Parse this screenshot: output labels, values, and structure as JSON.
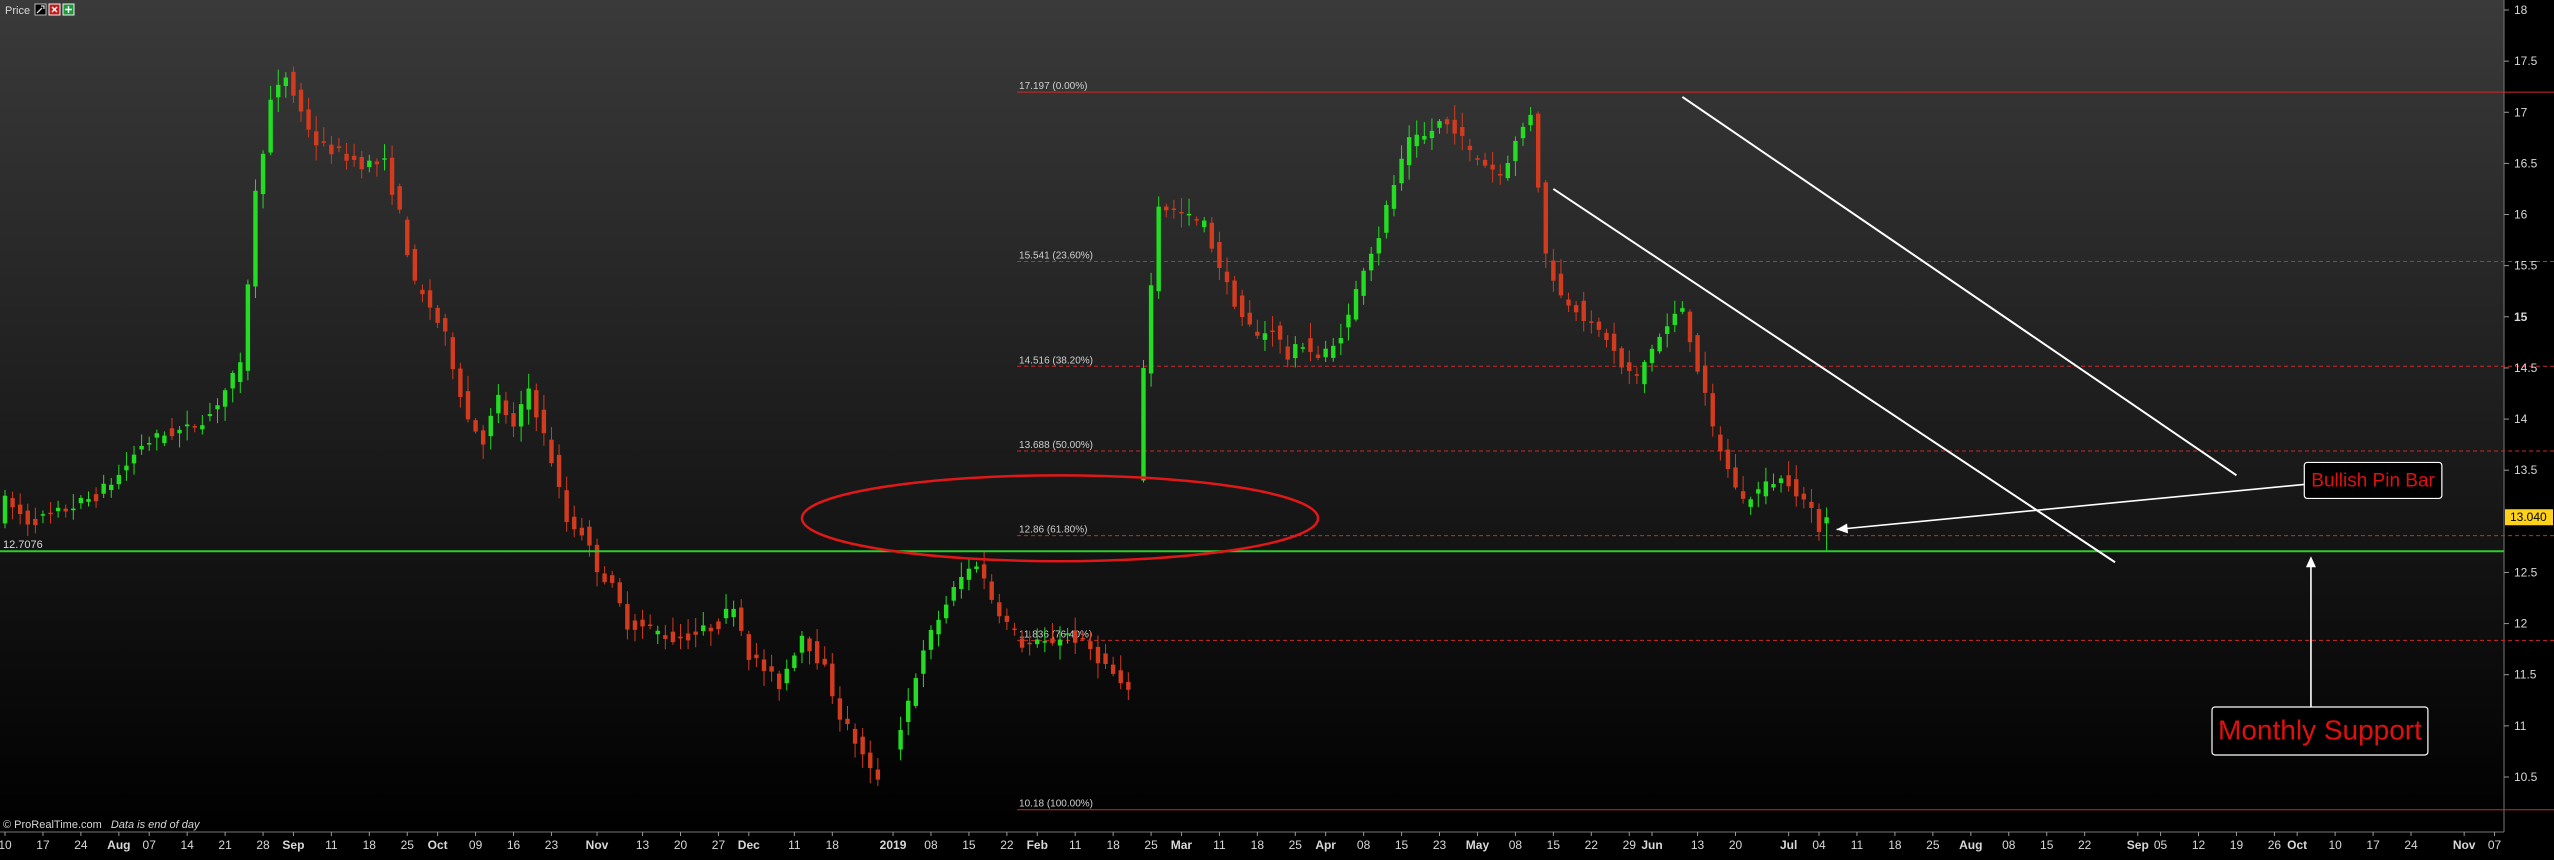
{
  "header": {
    "label": "Price",
    "tool_icons": [
      "wrench-icon",
      "close-icon",
      "add-icon"
    ]
  },
  "footer": {
    "source": "© ProRealTime.com",
    "note": "Data is end of day"
  },
  "colors": {
    "background_top": "#3a3a3a",
    "background_bottom": "#000000",
    "up_candle": "#22dd22",
    "down_candle": "#d23b1e",
    "support_line": "#2ecc2e",
    "fib_line": "#cc2a2a",
    "annotation_text": "#e01010",
    "channel": "#ffffff",
    "price_tag": "#ffd21a"
  },
  "chart_data": {
    "type": "candlestick",
    "y_axis": {
      "min": 10.0,
      "max": 18.2,
      "ticks": [
        {
          "value": 18,
          "label": "18"
        },
        {
          "value": 17.5,
          "label": "17.5"
        },
        {
          "value": 17,
          "label": "17"
        },
        {
          "value": 16.5,
          "label": "16.5"
        },
        {
          "value": 16,
          "label": "16"
        },
        {
          "value": 15.5,
          "label": "15.5"
        },
        {
          "value": 15,
          "label": "15"
        },
        {
          "value": 14.5,
          "label": "14.5"
        },
        {
          "value": 14,
          "label": "14"
        },
        {
          "value": 13.5,
          "label": "13.5"
        },
        {
          "value": 12.5,
          "label": "12.5"
        },
        {
          "value": 12,
          "label": "12"
        },
        {
          "value": 11.5,
          "label": "11.5"
        },
        {
          "value": 11,
          "label": "11"
        },
        {
          "value": 10.5,
          "label": "10.5"
        }
      ]
    },
    "x_axis": {
      "ticks": [
        {
          "i": 0,
          "label": "10"
        },
        {
          "i": 5,
          "label": "17"
        },
        {
          "i": 10,
          "label": "24"
        },
        {
          "i": 15,
          "label": "Aug",
          "bold": true
        },
        {
          "i": 19,
          "label": "07"
        },
        {
          "i": 24,
          "label": "14"
        },
        {
          "i": 29,
          "label": "21"
        },
        {
          "i": 34,
          "label": "28"
        },
        {
          "i": 38,
          "label": "Sep",
          "bold": true
        },
        {
          "i": 43,
          "label": "11"
        },
        {
          "i": 48,
          "label": "18"
        },
        {
          "i": 53,
          "label": "25"
        },
        {
          "i": 57,
          "label": "Oct",
          "bold": true
        },
        {
          "i": 62,
          "label": "09"
        },
        {
          "i": 67,
          "label": "16"
        },
        {
          "i": 72,
          "label": "23"
        },
        {
          "i": 78,
          "label": "Nov",
          "bold": true
        },
        {
          "i": 84,
          "label": "13"
        },
        {
          "i": 89,
          "label": "20"
        },
        {
          "i": 94,
          "label": "27"
        },
        {
          "i": 98,
          "label": "Dec",
          "bold": true
        },
        {
          "i": 104,
          "label": "11"
        },
        {
          "i": 109,
          "label": "18"
        },
        {
          "i": 117,
          "label": "2019",
          "bold": true
        },
        {
          "i": 122,
          "label": "08"
        },
        {
          "i": 127,
          "label": "15"
        },
        {
          "i": 132,
          "label": "22"
        },
        {
          "i": 136,
          "label": "Feb",
          "bold": true
        },
        {
          "i": 141,
          "label": "11"
        },
        {
          "i": 146,
          "label": "18"
        },
        {
          "i": 151,
          "label": "25"
        },
        {
          "i": 155,
          "label": "Mar",
          "bold": true
        },
        {
          "i": 160,
          "label": "11"
        },
        {
          "i": 165,
          "label": "18"
        },
        {
          "i": 170,
          "label": "25"
        },
        {
          "i": 174,
          "label": "Apr",
          "bold": true
        },
        {
          "i": 179,
          "label": "08"
        },
        {
          "i": 184,
          "label": "15"
        },
        {
          "i": 189,
          "label": "23"
        },
        {
          "i": 194,
          "label": "May",
          "bold": true
        },
        {
          "i": 199,
          "label": "08"
        },
        {
          "i": 204,
          "label": "15"
        },
        {
          "i": 209,
          "label": "22"
        },
        {
          "i": 214,
          "label": "29"
        },
        {
          "i": 217,
          "label": "Jun",
          "bold": true
        },
        {
          "i": 223,
          "label": "13"
        },
        {
          "i": 228,
          "label": "20"
        },
        {
          "i": 235,
          "label": "Jul",
          "bold": true
        },
        {
          "i": 239,
          "label": "04"
        },
        {
          "i": 244,
          "label": "11"
        },
        {
          "i": 249,
          "label": "18"
        },
        {
          "i": 254,
          "label": "25"
        },
        {
          "i": 259,
          "label": "Aug",
          "bold": true
        },
        {
          "i": 264,
          "label": "08"
        },
        {
          "i": 269,
          "label": "15"
        },
        {
          "i": 274,
          "label": "22"
        },
        {
          "i": 281,
          "label": "Sep",
          "bold": true
        },
        {
          "i": 284,
          "label": "05"
        },
        {
          "i": 289,
          "label": "12"
        },
        {
          "i": 294,
          "label": "19"
        },
        {
          "i": 299,
          "label": "26"
        },
        {
          "i": 302,
          "label": "Oct",
          "bold": true
        },
        {
          "i": 307,
          "label": "10"
        },
        {
          "i": 312,
          "label": "17"
        },
        {
          "i": 317,
          "label": "24"
        },
        {
          "i": 324,
          "label": "Nov",
          "bold": true
        },
        {
          "i": 328,
          "label": "07"
        }
      ]
    },
    "price_path": [
      [
        0,
        13.2
      ],
      [
        3,
        13.0
      ],
      [
        6,
        13.05
      ],
      [
        9,
        13.15
      ],
      [
        12,
        13.25
      ],
      [
        15,
        13.45
      ],
      [
        18,
        13.75
      ],
      [
        21,
        13.85
      ],
      [
        24,
        13.9
      ],
      [
        27,
        14.05
      ],
      [
        30,
        14.4
      ],
      [
        31,
        14.5
      ],
      [
        33,
        16.2
      ],
      [
        35,
        17.1
      ],
      [
        37,
        17.35
      ],
      [
        39,
        17.0
      ],
      [
        41,
        16.7
      ],
      [
        44,
        16.6
      ],
      [
        47,
        16.5
      ],
      [
        50,
        16.5
      ],
      [
        52,
        16.0
      ],
      [
        54,
        15.3
      ],
      [
        56,
        15.1
      ],
      [
        58,
        14.8
      ],
      [
        61,
        14.0
      ],
      [
        63,
        13.8
      ],
      [
        65,
        14.2
      ],
      [
        67,
        13.9
      ],
      [
        69,
        14.3
      ],
      [
        72,
        13.6
      ],
      [
        74,
        13.0
      ],
      [
        76,
        12.9
      ],
      [
        78,
        12.55
      ],
      [
        80,
        12.35
      ],
      [
        82,
        12.0
      ],
      [
        85,
        11.95
      ],
      [
        88,
        11.85
      ],
      [
        91,
        11.9
      ],
      [
        94,
        12.0
      ],
      [
        96,
        12.2
      ],
      [
        98,
        11.7
      ],
      [
        100,
        11.55
      ],
      [
        102,
        11.4
      ],
      [
        105,
        11.9
      ],
      [
        108,
        11.55
      ],
      [
        110,
        11.1
      ],
      [
        112,
        10.85
      ],
      [
        114,
        10.55
      ],
      [
        116,
        10.45
      ],
      [
        118,
        11.0
      ],
      [
        120,
        11.5
      ],
      [
        122,
        11.9
      ],
      [
        124,
        12.2
      ],
      [
        126,
        12.45
      ],
      [
        128,
        12.6
      ],
      [
        130,
        12.25
      ],
      [
        132,
        12.0
      ],
      [
        134,
        11.8
      ],
      [
        137,
        11.8
      ],
      [
        140,
        11.9
      ],
      [
        143,
        11.75
      ],
      [
        146,
        11.5
      ],
      [
        148,
        11.3
      ],
      [
        150,
        14.5
      ],
      [
        152,
        16.1
      ],
      [
        155,
        16.0
      ],
      [
        158,
        15.9
      ],
      [
        161,
        15.3
      ],
      [
        163,
        15.0
      ],
      [
        165,
        14.8
      ],
      [
        167,
        14.9
      ],
      [
        169,
        14.6
      ],
      [
        171,
        14.75
      ],
      [
        173,
        14.6
      ],
      [
        175,
        14.7
      ],
      [
        177,
        15.0
      ],
      [
        179,
        15.5
      ],
      [
        181,
        15.8
      ],
      [
        183,
        16.3
      ],
      [
        185,
        16.7
      ],
      [
        187,
        16.75
      ],
      [
        189,
        16.9
      ],
      [
        191,
        16.85
      ],
      [
        193,
        16.6
      ],
      [
        195,
        16.5
      ],
      [
        197,
        16.4
      ],
      [
        199,
        16.7
      ],
      [
        201,
        17.0
      ],
      [
        203,
        15.6
      ],
      [
        205,
        15.2
      ],
      [
        207,
        15.1
      ],
      [
        209,
        14.9
      ],
      [
        211,
        14.8
      ],
      [
        213,
        14.5
      ],
      [
        215,
        14.4
      ],
      [
        217,
        14.7
      ],
      [
        219,
        14.9
      ],
      [
        221,
        15.1
      ],
      [
        223,
        14.5
      ],
      [
        225,
        13.9
      ],
      [
        227,
        13.5
      ],
      [
        229,
        13.2
      ],
      [
        231,
        13.3
      ],
      [
        233,
        13.4
      ],
      [
        235,
        13.4
      ],
      [
        237,
        13.2
      ],
      [
        239,
        12.95
      ],
      [
        240,
        13.04
      ]
    ],
    "fibonacci_levels": [
      {
        "value": 17.197,
        "label": "17.197 (0.00%)",
        "style": "solid"
      },
      {
        "value": 15.541,
        "label": "15.541 (23.60%)",
        "style": "dashed"
      },
      {
        "value": 14.516,
        "label": "14.516 (38.20%)",
        "style": "dashed"
      },
      {
        "value": 13.688,
        "label": "13.688 (50.00%)",
        "style": "dashed"
      },
      {
        "value": 12.86,
        "label": "12.86 (61.80%)",
        "style": "dashed"
      },
      {
        "value": 11.836,
        "label": "11.836 (76.40%)",
        "style": "dashed"
      },
      {
        "value": 10.18,
        "label": "10.18 (100.00%)",
        "style": "solid"
      }
    ],
    "fib_x_range": [
      134,
      360
    ],
    "support_level": {
      "value": 12.7076,
      "label": "12.7076"
    },
    "last_price": {
      "value": 13.04,
      "label": "13.040"
    },
    "channel_lines": [
      {
        "from": [
          221,
          17.15
        ],
        "to": [
          294,
          13.45
        ]
      },
      {
        "from": [
          204,
          16.25
        ],
        "to": [
          278,
          12.6
        ]
      }
    ],
    "annotations": [
      {
        "text": "Bullish Pin Bar",
        "i": 312,
        "v": 13.4
      },
      {
        "text": "Monthly Support",
        "i": 305,
        "v": 10.95
      }
    ],
    "ellipse": {
      "center": [
        139,
        13.03
      ],
      "radius_bars": 34,
      "radius_value": 0.42
    }
  }
}
